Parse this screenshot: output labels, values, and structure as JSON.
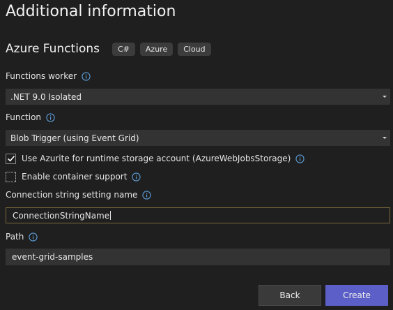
{
  "title": "Additional information",
  "project": {
    "name": "Azure Functions",
    "tags": [
      "C#",
      "Azure",
      "Cloud"
    ]
  },
  "worker": {
    "label": "Functions worker",
    "value": ".NET 9.0 Isolated"
  },
  "function": {
    "label": "Function",
    "value": "Blob Trigger (using Event Grid)"
  },
  "azurite": {
    "label": "Use Azurite for runtime storage account (AzureWebJobsStorage)",
    "checked": true
  },
  "container": {
    "label": "Enable container support",
    "checked": false
  },
  "connection": {
    "label": "Connection string setting name",
    "value": "ConnectionStringName"
  },
  "path": {
    "label": "Path",
    "value": "event-grid-samples"
  },
  "buttons": {
    "back": "Back",
    "create": "Create"
  },
  "colors": {
    "background": "#1f1f1f",
    "field": "#333333",
    "primary_button": "#5b5fc7",
    "info_icon": "#5b9bd5",
    "focus_border": "#7a6a3a"
  },
  "icons": {
    "info": "info-icon",
    "check": "checkmark-icon",
    "dropdown": "chevron-down-icon"
  }
}
